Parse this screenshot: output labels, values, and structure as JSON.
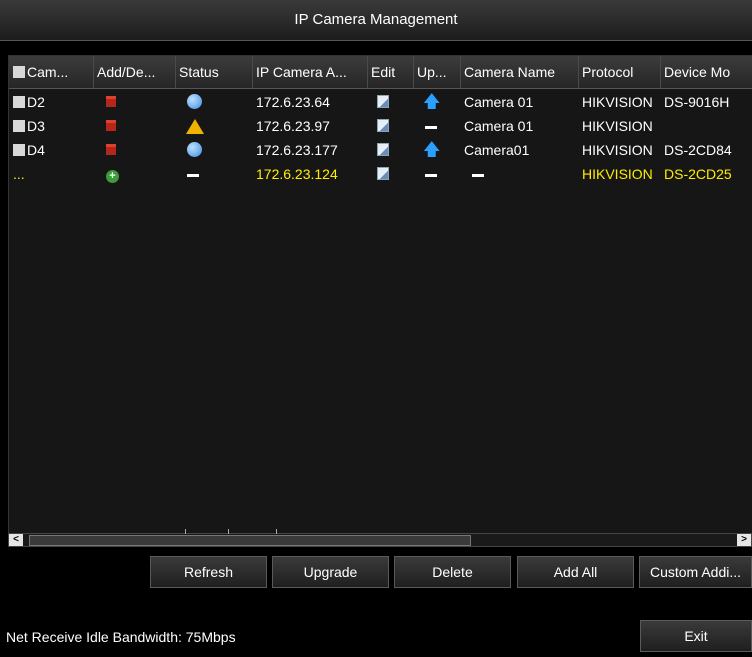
{
  "window": {
    "title": "IP Camera Management"
  },
  "table": {
    "columns": [
      "Cam...",
      "Add/De...",
      "Status",
      "IP Camera A...",
      "Edit",
      "Up...",
      "Camera Name",
      "Protocol",
      "Device Mo"
    ],
    "rows": [
      {
        "cam": "D2",
        "action": "delete",
        "status": "online",
        "ip": "172.6.23.64",
        "upgrade": "upgrade",
        "name": "Camera 01",
        "protocol": "HIKVISION",
        "model": "DS-9016H"
      },
      {
        "cam": "D3",
        "action": "delete",
        "status": "warning",
        "ip": "172.6.23.97",
        "upgrade": "none",
        "name": "Camera 01",
        "protocol": "HIKVISION",
        "model": ""
      },
      {
        "cam": "D4",
        "action": "delete",
        "status": "online",
        "ip": "172.6.23.177",
        "upgrade": "upgrade",
        "name": "Camera01",
        "protocol": "HIKVISION",
        "model": "DS-2CD84"
      },
      {
        "cam": "...",
        "action": "add",
        "status": "none",
        "ip": "172.6.23.124",
        "upgrade": "none",
        "name": "",
        "protocol": "HIKVISION",
        "model": "DS-2CD25"
      }
    ]
  },
  "buttons": {
    "refresh": "Refresh",
    "upgrade": "Upgrade",
    "delete": "Delete",
    "add_all": "Add All",
    "custom_add": "Custom Addi...",
    "exit": "Exit"
  },
  "footer": {
    "bandwidth": "Net Receive Idle Bandwidth: 75Mbps"
  },
  "colors": {
    "pending_row_text": "#ffee00",
    "online_status": "#3c8de0",
    "warning_status": "#f0b400"
  }
}
